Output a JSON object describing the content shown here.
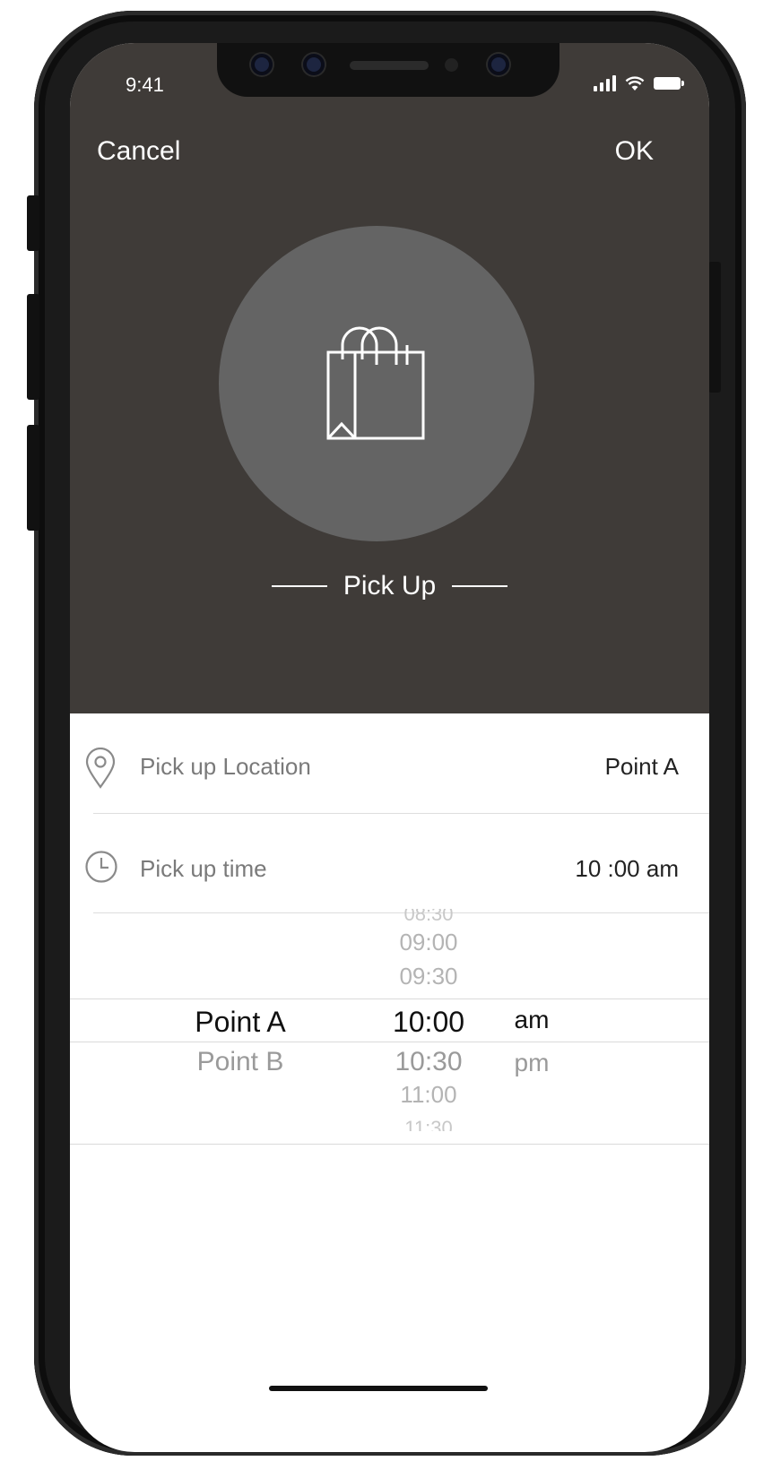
{
  "status_bar": {
    "time": "9:41"
  },
  "nav": {
    "cancel_label": "Cancel",
    "ok_label": "OK"
  },
  "hero": {
    "title": "Pick Up",
    "icon": "shopping-bag-icon"
  },
  "location_row": {
    "label": "Pick up Location",
    "value": "Point A",
    "icon": "location-pin-icon"
  },
  "time_row": {
    "label": "Pick up time",
    "value": "10 :00 am",
    "icon": "clock-icon"
  },
  "picker": {
    "locations": [
      "Point A",
      "Point B"
    ],
    "times": [
      "08:30",
      "09:00",
      "09:30",
      "10:00",
      "10:30",
      "11:00",
      "11:30"
    ],
    "periods": [
      "am",
      "pm"
    ],
    "selected": {
      "location": "Point A",
      "time": "10:00",
      "period": "am"
    }
  },
  "colors": {
    "header_bg": "#3f3b38",
    "circle_bg": "#646464",
    "text_primary": "#222222",
    "text_muted": "#7a7a7a"
  }
}
